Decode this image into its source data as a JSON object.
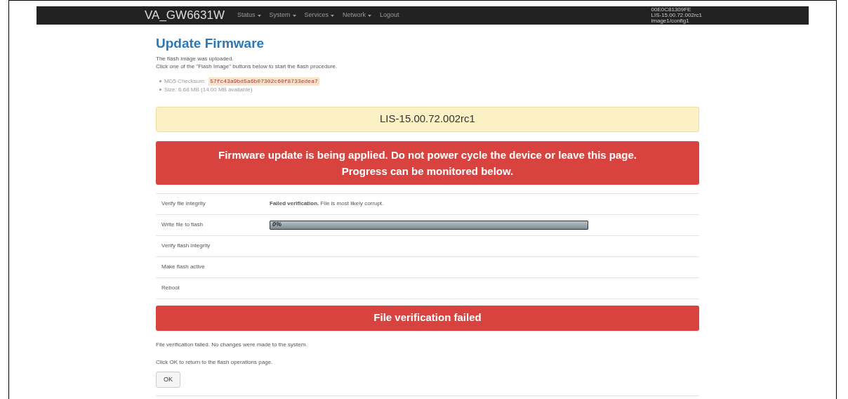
{
  "navbar": {
    "brand": "VA_GW6631W",
    "menu": [
      {
        "label": "Status",
        "dropdown": true
      },
      {
        "label": "System",
        "dropdown": true
      },
      {
        "label": "Services",
        "dropdown": true
      },
      {
        "label": "Network",
        "dropdown": true
      },
      {
        "label": "Logout",
        "dropdown": false
      }
    ],
    "info_lines": [
      "00E0C81309FE",
      "LIS-15.00.72.002rc1",
      "image1/config1"
    ]
  },
  "title": "Update Firmware",
  "intro": [
    "The flash image was uploaded.",
    "Click one of the \"Flash Image\" buttons below to start the flash procedure."
  ],
  "details": [
    {
      "label": "MD5 Checksum:",
      "value": "57fc43a9bd5a6b07302c60f8733edea7",
      "kind": "code"
    },
    {
      "label": "Size: 6.68 MB (14.00 MB available)",
      "kind": "plain"
    }
  ],
  "version_banner": "LIS-15.00.72.002rc1",
  "warning_banner": [
    "Firmware update is being applied. Do not power cycle the device or leave this page.",
    "Progress can be monitored below."
  ],
  "steps": [
    {
      "label": "Verify file integrity",
      "kind": "message",
      "message": "**Failed verification.** File is most likely corrupt."
    },
    {
      "label": "Write file to flash",
      "kind": "progress",
      "level": 0,
      "reading": "0%"
    },
    {
      "label": "Verify flash integrity",
      "kind": "empty"
    },
    {
      "label": "Make flash active",
      "kind": "empty"
    },
    {
      "label": "Reboot",
      "kind": "empty"
    }
  ],
  "result_banner": "File verification failed",
  "result_text": [
    "File verification failed. No changes were made to the system.",
    "Click OK to return to the flash operations page."
  ],
  "ok_button": "OK"
}
